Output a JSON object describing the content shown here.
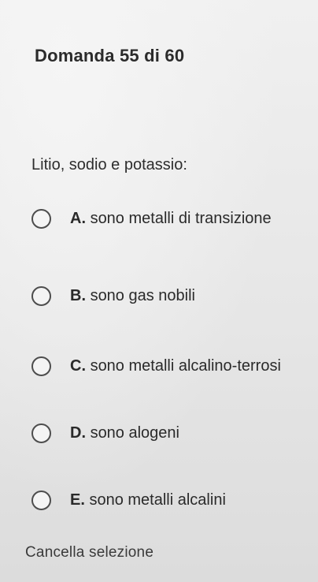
{
  "header": {
    "title": "Domanda 55 di 60"
  },
  "question": {
    "text": "Litio, sodio e potassio:"
  },
  "options": [
    {
      "letter": "A.",
      "text": "sono metalli di transizione"
    },
    {
      "letter": "B.",
      "text": "sono gas nobili"
    },
    {
      "letter": "C.",
      "text": "sono metalli alcalino-terrosi"
    },
    {
      "letter": "D.",
      "text": "sono alogeni"
    },
    {
      "letter": "E.",
      "text": "sono metalli alcalini"
    }
  ],
  "footer": {
    "clear_label": "Cancella selezione"
  }
}
